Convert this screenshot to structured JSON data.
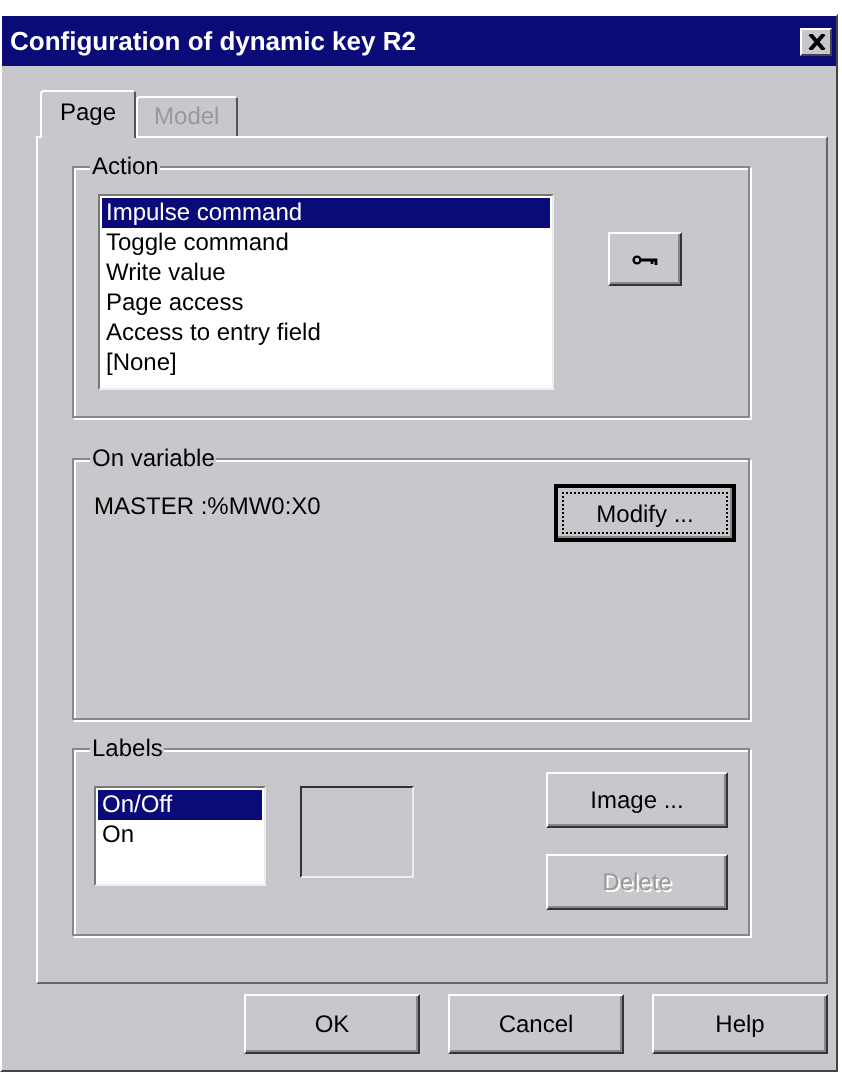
{
  "window": {
    "title": "Configuration of dynamic key R2"
  },
  "tabs": [
    {
      "label": "Page",
      "selected": true,
      "disabled": false
    },
    {
      "label": "Model",
      "selected": false,
      "disabled": true
    }
  ],
  "action": {
    "title": "Action",
    "items": [
      {
        "label": "Impulse command",
        "selected": true
      },
      {
        "label": "Toggle command",
        "selected": false
      },
      {
        "label": "Write value",
        "selected": false
      },
      {
        "label": "Page access",
        "selected": false
      },
      {
        "label": "Access to entry field",
        "selected": false
      },
      {
        "label": "[None]",
        "selected": false
      }
    ]
  },
  "on_variable": {
    "title": "On variable",
    "value": "MASTER :%MW0:X0",
    "button": {
      "label": "Modify ...",
      "default": true
    }
  },
  "labels": {
    "title": "Labels",
    "items": [
      {
        "label": "On/Off",
        "selected": true
      },
      {
        "label": "On",
        "selected": false
      }
    ],
    "buttons": [
      {
        "label": "Image ...",
        "disabled": false
      },
      {
        "label": "Delete",
        "disabled": true
      }
    ]
  },
  "buttons": [
    "OK",
    "Cancel",
    "Help"
  ]
}
